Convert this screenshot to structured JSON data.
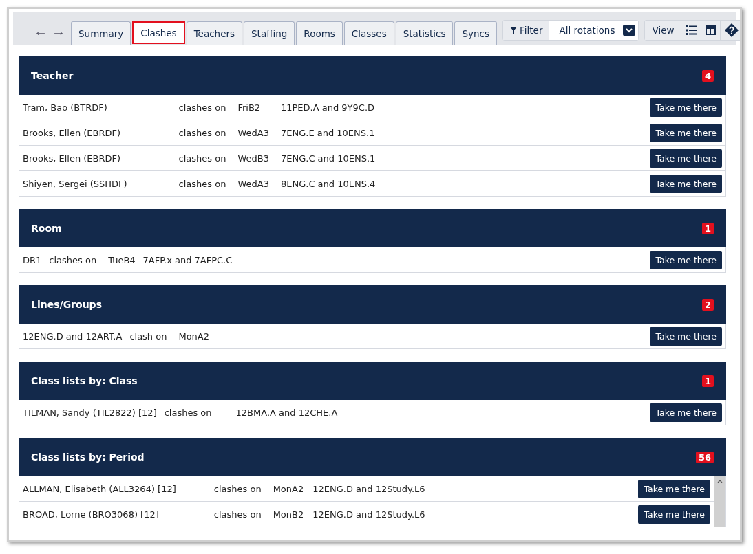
{
  "nav": {
    "back": "←",
    "forward": "→"
  },
  "tabs": [
    {
      "label": "Summary",
      "selected": false
    },
    {
      "label": "Clashes",
      "selected": true
    },
    {
      "label": "Teachers",
      "selected": false
    },
    {
      "label": "Staffing",
      "selected": false
    },
    {
      "label": "Rooms",
      "selected": false
    },
    {
      "label": "Classes",
      "selected": false
    },
    {
      "label": "Statistics",
      "selected": false
    },
    {
      "label": "Syncs",
      "selected": false
    }
  ],
  "filter": {
    "label": "Filter",
    "value": "All rotations"
  },
  "view": {
    "label": "View"
  },
  "sections": [
    {
      "title": "Teacher",
      "count": "4",
      "rows": [
        {
          "cells": [
            "Tram, Bao (BTRDF)",
            "clashes on",
            "FriB2",
            "11PED.A and 9Y9C.D"
          ],
          "action": "Take me there"
        },
        {
          "cells": [
            "Brooks, Ellen (EBRDF)",
            "clashes on",
            "WedA3",
            "7ENG.E and 10ENS.1"
          ],
          "action": "Take me there"
        },
        {
          "cells": [
            "Brooks, Ellen (EBRDF)",
            "clashes on",
            "WedB3",
            "7ENG.C and 10ENS.1"
          ],
          "action": "Take me there"
        },
        {
          "cells": [
            "Shiyen, Sergei (SSHDF)",
            "clashes on",
            "WedA3",
            "8ENG.C and 10ENS.4"
          ],
          "action": "Take me there"
        }
      ]
    },
    {
      "title": "Room",
      "count": "1",
      "rows": [
        {
          "cells": [
            "DR1",
            "clashes on",
            "TueB4",
            "7AFP.x and 7AFPC.C"
          ],
          "action": "Take me there"
        }
      ]
    },
    {
      "title": "Lines/Groups",
      "count": "2",
      "rows": [
        {
          "cells": [
            "12ENG.D and 12ART.A",
            "clash on",
            "MonA2"
          ],
          "action": "Take me there"
        }
      ]
    },
    {
      "title": "Class lists by: Class",
      "count": "1",
      "rows": [
        {
          "cells": [
            "TILMAN, Sandy (TIL2822) [12]",
            "clashes on",
            "12BMA.A and 12CHE.A"
          ],
          "action": "Take me there"
        }
      ]
    },
    {
      "title": "Class lists by: Period",
      "count": "56",
      "scroll": true,
      "rows": [
        {
          "cells": [
            "ALLMAN, Elisabeth (ALL3264) [12]",
            "clashes on",
            "MonA2",
            "12ENG.D and 12Study.L6"
          ],
          "action": "Take me there"
        },
        {
          "cells": [
            "BROAD, Lorne (BRO3068) [12]",
            "clashes on",
            "MonB2",
            "12ENG.D and 12Study.L6"
          ],
          "action": "Take me there"
        }
      ]
    }
  ]
}
